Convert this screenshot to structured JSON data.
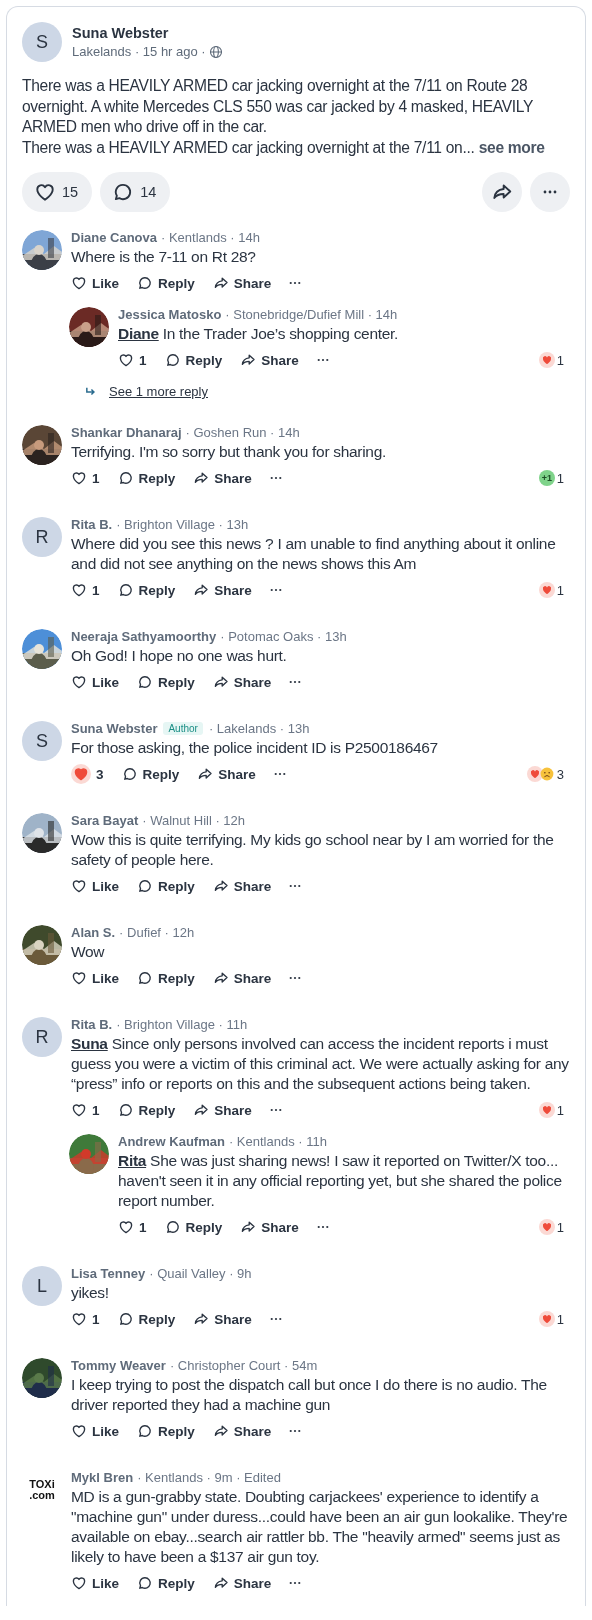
{
  "post": {
    "author": {
      "name": "Suna Webster",
      "initial": "S"
    },
    "meta": "Lakelands · 15 hr ago ·",
    "paragraphs": [
      "There was a HEAVILY ARMED car jacking overnight at the 7/11 on Route 28 overnight. A white Mercedes CLS 550 was car jacked by 4 masked,  HEAVILY ARMED men who drive off in the car.",
      "There was a HEAVILY ARMED car jacking overnight at the 7/11 on..."
    ],
    "see_more": "see more",
    "likes": "15",
    "comments": "14"
  },
  "comments": [
    {
      "avatar": {
        "kind": "picture"
      },
      "name": "Diane Canova",
      "meta": "· Kentlands · 14h",
      "text": "Where is the 7-11 on Rt 28?",
      "like": {
        "label": "Like",
        "liked": false
      },
      "reply": "Reply",
      "share": "Share",
      "replies": [
        {
          "avatar": {
            "kind": "picture"
          },
          "name": "Jessica Matosko",
          "meta": "· Stonebridge/Dufief Mill · 14h",
          "mention": "Diane",
          "text": "In the Trader Joe’s shopping center.",
          "like": {
            "label": "1",
            "liked": false
          },
          "reply": "Reply",
          "share": "Share",
          "reactions": [
            {
              "kind": "heart"
            }
          ],
          "reaction_count": "1"
        }
      ],
      "more_replies": "See 1 more reply"
    },
    {
      "avatar": {
        "kind": "picture"
      },
      "name": "Shankar Dhanaraj",
      "meta": "· Goshen Run · 14h",
      "text": "Terrifying. I'm so sorry but thank you for sharing.",
      "like": {
        "label": "1",
        "liked": false
      },
      "reply": "Reply",
      "share": "Share",
      "reactions": [
        {
          "kind": "badge",
          "label": "+1"
        }
      ],
      "reaction_count": "1"
    },
    {
      "avatar": {
        "kind": "initial",
        "text": "R"
      },
      "name": "Rita B.",
      "meta": "· Brighton Village · 13h",
      "text": "Where did you see this news ? I am unable to find anything about it online and did not see anything on the news shows this Am",
      "like": {
        "label": "1",
        "liked": false
      },
      "reply": "Reply",
      "share": "Share",
      "reactions": [
        {
          "kind": "heart"
        }
      ],
      "reaction_count": "1"
    },
    {
      "avatar": {
        "kind": "picture"
      },
      "name": "Neeraja Sathyamoorthy",
      "meta": "· Potomac Oaks · 13h",
      "text": "Oh God! I hope no one was hurt.",
      "like": {
        "label": "Like",
        "liked": false
      },
      "reply": "Reply",
      "share": "Share"
    },
    {
      "avatar": {
        "kind": "initial",
        "text": "S"
      },
      "name": "Suna Webster",
      "author_tag": "Author",
      "meta": "· Lakelands · 13h",
      "text": "For those asking, the police incident ID is P2500186467",
      "like": {
        "label": "3",
        "liked": true
      },
      "reply": "Reply",
      "share": "Share",
      "reactions": [
        {
          "kind": "heart"
        },
        {
          "kind": "sad"
        }
      ],
      "reaction_count": "3"
    },
    {
      "avatar": {
        "kind": "picture"
      },
      "name": "Sara Bayat",
      "meta": "· Walnut Hill · 12h",
      "text": "Wow this is quite terrifying. My kids go school near by I am worried for the safety of people here.",
      "like": {
        "label": "Like",
        "liked": false
      },
      "reply": "Reply",
      "share": "Share"
    },
    {
      "avatar": {
        "kind": "picture"
      },
      "name": "Alan S.",
      "meta": "· Dufief · 12h",
      "text": "Wow",
      "like": {
        "label": "Like",
        "liked": false
      },
      "reply": "Reply",
      "share": "Share"
    },
    {
      "avatar": {
        "kind": "initial",
        "text": "R"
      },
      "name": "Rita B.",
      "meta": "· Brighton Village · 11h",
      "mention": "Suna",
      "text": " Since only persons involved can access the incident reports i must guess you were a victim of this criminal act. We were actually asking for any “press” info or reports on this and the subsequent actions being taken.",
      "like": {
        "label": "1",
        "liked": false
      },
      "reply": "Reply",
      "share": "Share",
      "reactions": [
        {
          "kind": "heart"
        }
      ],
      "reaction_count": "1",
      "replies": [
        {
          "avatar": {
            "kind": "picture"
          },
          "name": "Andrew Kaufman",
          "meta": "· Kentlands · 11h",
          "mention": "Rita",
          "text": "She was just sharing news! I saw it reported on Twitter/X too... haven't seen it in any official reporting yet, but she shared the police report number.",
          "like": {
            "label": "1",
            "liked": false
          },
          "reply": "Reply",
          "share": "Share",
          "reactions": [
            {
              "kind": "heart"
            }
          ],
          "reaction_count": "1"
        }
      ]
    },
    {
      "avatar": {
        "kind": "initial",
        "text": "L"
      },
      "name": "Lisa Tenney",
      "meta": "· Quail Valley · 9h",
      "text": "yikes!",
      "like": {
        "label": "1",
        "liked": false
      },
      "reply": "Reply",
      "share": "Share",
      "reactions": [
        {
          "kind": "heart"
        }
      ],
      "reaction_count": "1"
    },
    {
      "avatar": {
        "kind": "picture"
      },
      "name": "Tommy Weaver",
      "meta": "· Christopher Court · 54m",
      "text": "I keep trying to post the dispatch call but once I do there is no audio.     The driver reported they had a machine gun",
      "like": {
        "label": "Like",
        "liked": false
      },
      "reply": "Reply",
      "share": "Share"
    },
    {
      "avatar": {
        "kind": "logo",
        "lines": [
          "TOXi",
          ".com"
        ]
      },
      "name": "Mykl Bren",
      "meta": "· Kentlands · 9m · Edited",
      "text": "MD is a gun-grabby state.  Doubting carjackees' experience to identify a \"machine gun\" under duress...could have been an air gun lookalike.  They're available on ebay...search air rattler bb.  The \"heavily armed\" seems just as likely to have been a $137 air gun toy.",
      "like": {
        "label": "Like",
        "liked": false
      },
      "reply": "Reply",
      "share": "Share"
    }
  ]
}
